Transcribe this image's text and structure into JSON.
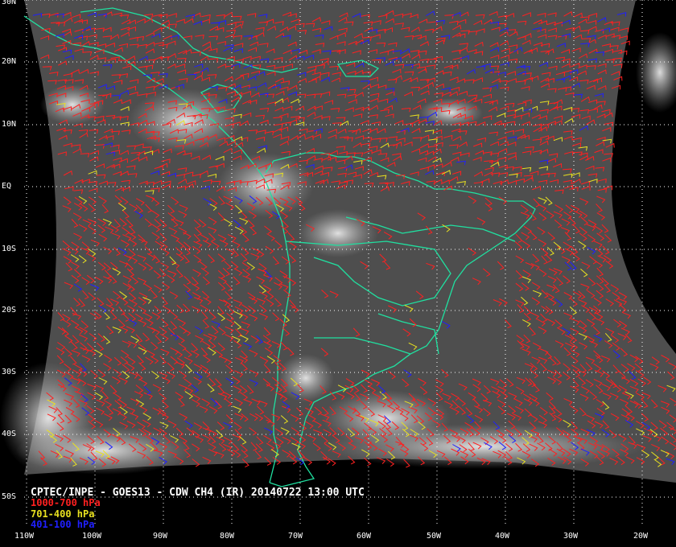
{
  "caption": "CPTEC/INPE - GOES13 - CDW CH4 (IR) 20140722 13:00 UTC",
  "legend": [
    {
      "label": "1000-700 hPa",
      "color": "#ff2020"
    },
    {
      "label": "701-400 hPa",
      "color": "#e8e020"
    },
    {
      "label": "401-100 hPa",
      "color": "#2020ff"
    }
  ],
  "lat_labels": [
    "30N",
    "20N",
    "10N",
    "EQ",
    "10S",
    "20S",
    "30S",
    "40S",
    "50S"
  ],
  "lon_labels": [
    "110W",
    "100W",
    "90W",
    "80W",
    "70W",
    "60W",
    "50W",
    "40W",
    "30W",
    "20W"
  ],
  "coastline_color": "#20e0a0",
  "grid_color": "#ffffff",
  "background_color": "#000000"
}
